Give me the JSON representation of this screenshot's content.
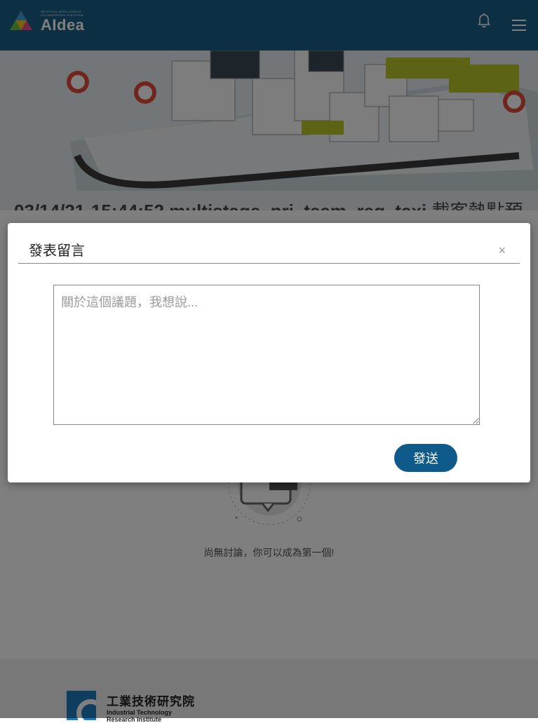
{
  "header": {
    "logo_tagline_1": "ARTIFICIAL INTELLIGENCE",
    "logo_tagline_2": "CO-INNOVATION PLATFORM",
    "logo_brand": "AIdea"
  },
  "hero": {
    "title_main": "03/14/21-15:44:52 multistage_pri_team_reg_taxi",
    "title_suffix": " 載客熱點預測"
  },
  "discussion": {
    "empty_text": "尚無討論，你可以成為第一個!"
  },
  "footer": {
    "org_name_cn": "工業技術研究院",
    "org_name_en_1": "Industrial Technology",
    "org_name_en_2": "Research Institute"
  },
  "modal": {
    "title": "發表留言",
    "close_symbol": "×",
    "textarea_placeholder": "關於這個議題，我想說...",
    "textarea_value": "",
    "send_label": "發送"
  },
  "colors": {
    "topbar": "#1b5f86",
    "send_button": "#0e5a8a",
    "footer_logo": "#1d7bbf"
  }
}
